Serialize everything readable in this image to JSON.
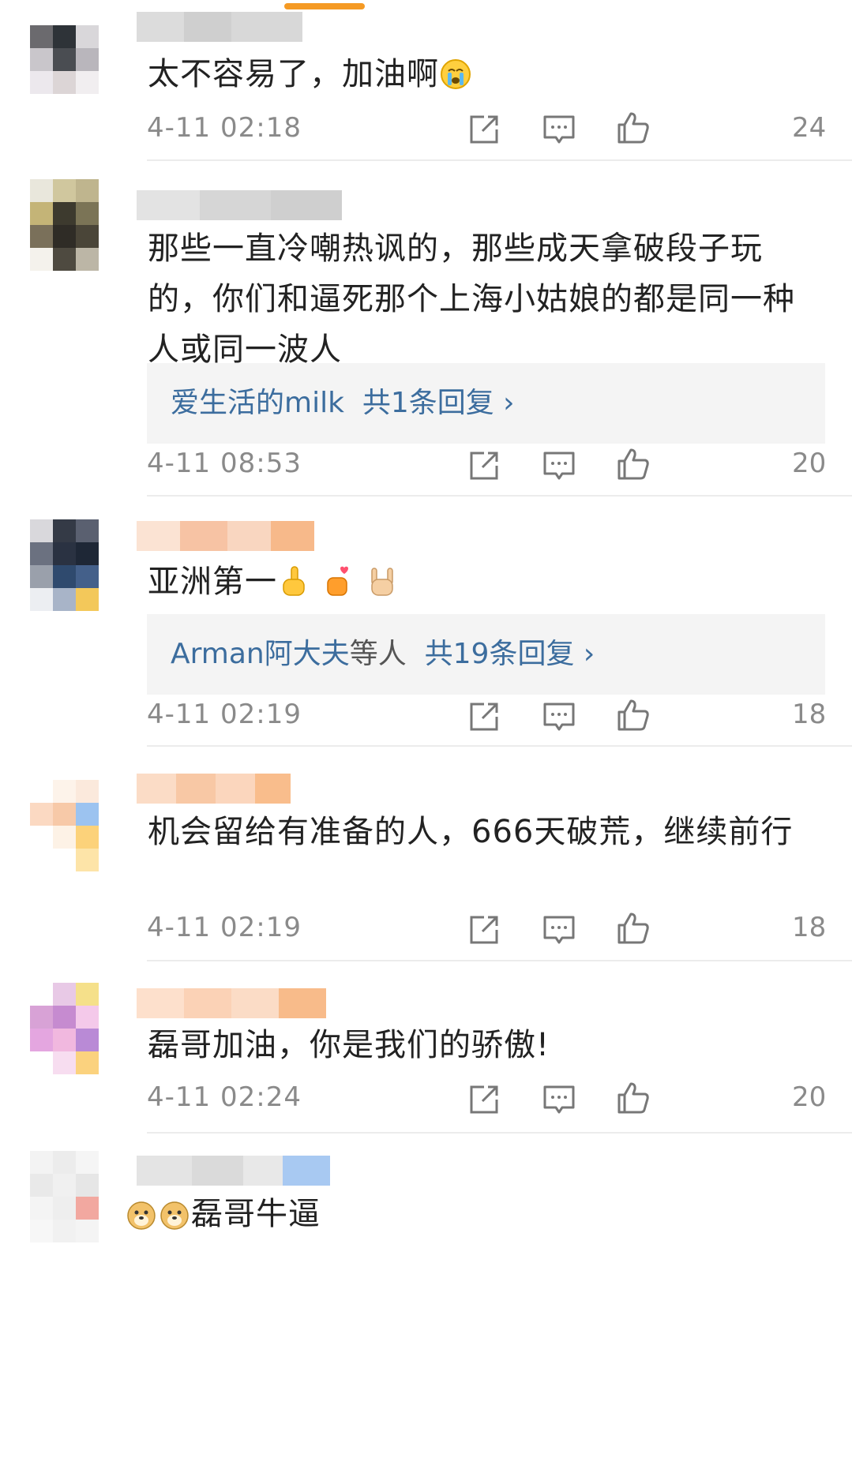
{
  "colors": {
    "accent": "#f59a24",
    "link": "#3c6d9e",
    "meta": "#8a8a8a",
    "reply_bg": "#f4f4f4"
  },
  "icons": {
    "share": "share-icon",
    "comment": "comment-icon",
    "like": "thumbs-up-icon"
  },
  "comments": [
    {
      "text": "太不容易了，加油啊",
      "text_emoji": "crying-face-emoji",
      "time": "4-11 02:18",
      "likes": "24"
    },
    {
      "text": "那些一直冷嘲热讽的，那些成天拿破段子玩的，你们和逼死那个上海小姑娘的都是同一种人或同一波人",
      "reply": {
        "users": "爱生活的milk",
        "suffix": "",
        "count": "共1条回复 ›"
      },
      "time": "4-11 08:53",
      "likes": "20"
    },
    {
      "text": "亚洲第一",
      "text_emoji": "fingers-up-emoji",
      "time": "4-11 02:19",
      "likes": "18",
      "reply": {
        "users": "Arman阿大夫",
        "suffix": "等人",
        "count": "共19条回复 ›"
      }
    },
    {
      "text": "机会留给有准备的人，666天破荒，继续前行",
      "time": "4-11 02:19",
      "likes": "18"
    },
    {
      "text": "磊哥加油，你是我们的骄傲!",
      "time": "4-11 02:24",
      "likes": "20"
    },
    {
      "text": "磊哥牛逼",
      "lead_emoji": "doge-emoji"
    }
  ]
}
